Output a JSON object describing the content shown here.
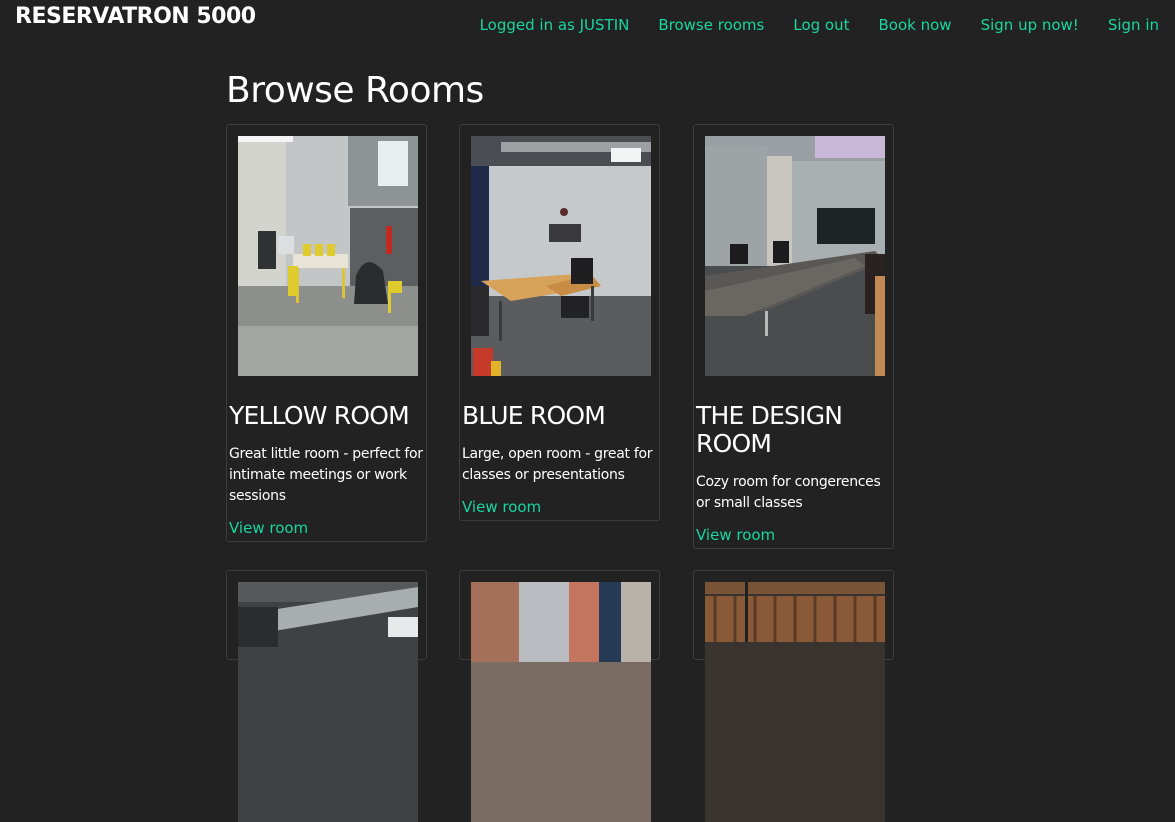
{
  "header": {
    "brand": "RESERVATRON 5000",
    "nav": [
      "Logged in as JUSTIN",
      "Browse rooms",
      "Log out",
      "Book now",
      "Sign up now!",
      "Sign in"
    ]
  },
  "page": {
    "title": "Browse Rooms"
  },
  "rooms": [
    {
      "name": "YELLOW ROOM",
      "description": "Great little room - perfect for intimate meetings or work sessions",
      "link": "View room"
    },
    {
      "name": "BLUE ROOM",
      "description": "Large, open room - great for classes or presentations",
      "link": "View room"
    },
    {
      "name": "THE DESIGN ROOM",
      "description": "Cozy room for congerences or small classes",
      "link": "View room"
    }
  ],
  "colors": {
    "background": "#222222",
    "accent": "#18d6a0",
    "text": "#ffffff",
    "card_border": "#3c3c3c"
  }
}
